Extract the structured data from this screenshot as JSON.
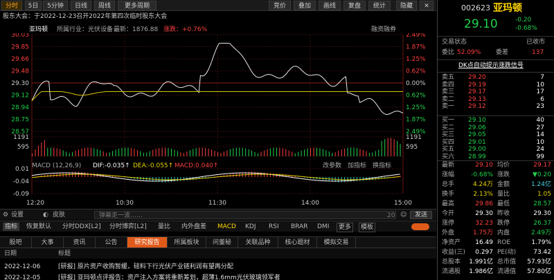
{
  "toolbar": {
    "tabs": [
      "分时",
      "5日",
      "5分钟",
      "日线",
      "周线",
      "更多周期"
    ],
    "right_buttons": [
      "竞价",
      "叠加",
      "画线",
      "复盘",
      "统计",
      "隐藏"
    ]
  },
  "notice": "股东大会：于2022-12-23召开2022年第四次临时股东大会",
  "chart_header": {
    "name": "亚玛顿",
    "industry": "所属行业：光伏设备",
    "latest": "最新：1876.88",
    "change": "涨跌：+0.76%",
    "margin": "融资融券"
  },
  "price_axis": {
    "left": [
      "30.03",
      "29.85",
      "29.66",
      "29.48",
      "29.30",
      "29.12",
      "28.94",
      "28.75",
      "28.57"
    ],
    "right": [
      "2.49%",
      "1.87%",
      "1.25%",
      "0.62%",
      "0.00%",
      "0.62%",
      "1.25%",
      "1.87%",
      "2.49%"
    ]
  },
  "volume_axis": {
    "left": [
      "1191",
      "595"
    ],
    "right": [
      "1191",
      "595"
    ]
  },
  "macd_header": {
    "name": "MACD (12,26,9)",
    "dif": "DIF:-0.035↑",
    "dea": "DEA:-0.055↑",
    "macd": "MACD:0.040↑",
    "buttons": [
      "改参数",
      "加指标",
      "换指标"
    ]
  },
  "macd_axis": {
    "left": [
      "0.01",
      "-0.04",
      "-0.09"
    ]
  },
  "time_axis": [
    "12:20",
    "10:30",
    "11:30",
    "14:00",
    "15:00"
  ],
  "input_bar": {
    "settings": "设置",
    "skin": "皮肤",
    "placeholder": "弹幕走一波……",
    "count": "20",
    "send": "发送"
  },
  "indicator_bar": {
    "items": [
      "指标",
      "恢复默认",
      "分时DDX[L2]",
      "分时博弈[L2]",
      "量比",
      "内外盘差",
      "MACD",
      "KDJ",
      "RSI",
      "BRAR",
      "DMI",
      "更多",
      "模板"
    ]
  },
  "tabs": [
    "股吧",
    "大事",
    "资讯",
    "公告",
    "研究报告",
    "所属板块",
    "问董秘",
    "关联品种",
    "核心题材",
    "模拟交易"
  ],
  "news_header": {
    "date": "日期",
    "title": "标题"
  },
  "news": [
    {
      "date": "2022-12-06",
      "text": "[研报] 原片资产收购暂缓，硅料下行光伏产业链利润有望再分配"
    },
    {
      "date": "2022-12-05",
      "text": "[研报] 亚玛顿点评报告：资产注入方案将重新筹划，超薄1.6mm光伏玻璃领军者"
    }
  ],
  "quote": {
    "code": "002623",
    "name": "亚玛顿",
    "price": "29.10",
    "change": "-0.20",
    "change_pct": "-0.68%",
    "status_label": "交易状态",
    "status": "已收市",
    "weibi_label": "委比",
    "weibi": "52.09%",
    "weicha_label": "委差",
    "weicha": "137",
    "dk_title": "DK点自动提示涨跌信号"
  },
  "sells": [
    {
      "label": "卖五",
      "price": "29.20",
      "vol": "7"
    },
    {
      "label": "卖四",
      "price": "29.19",
      "vol": "10"
    },
    {
      "label": "卖三",
      "price": "29.17",
      "vol": "17"
    },
    {
      "label": "卖二",
      "price": "29.13",
      "vol": "6"
    },
    {
      "label": "卖一",
      "price": "29.12",
      "vol": "23"
    }
  ],
  "buys": [
    {
      "label": "买一",
      "price": "29.10",
      "vol": "40"
    },
    {
      "label": "买二",
      "price": "29.06",
      "vol": "27"
    },
    {
      "label": "买三",
      "price": "29.05",
      "vol": "14"
    },
    {
      "label": "买四",
      "price": "29.01",
      "vol": "10"
    },
    {
      "label": "买五",
      "price": "29.00",
      "vol": "24"
    },
    {
      "label": "买六",
      "price": "28.99",
      "vol": "99"
    }
  ],
  "stats": [
    {
      "l1": "最新",
      "v1": "29.10",
      "c1": "red",
      "l2": "均价",
      "v2": "29.17",
      "c2": "red"
    },
    {
      "l1": "涨幅",
      "v1": "-0.68%",
      "c1": "green",
      "l2": "涨跌",
      "v2": "▼0.20",
      "c2": "green"
    },
    {
      "l1": "总手",
      "v1": "4.24万",
      "c1": "yellow",
      "l2": "金额",
      "v2": "1.24亿",
      "c2": "cyan"
    },
    {
      "l1": "换手",
      "v1": "2.13%",
      "c1": "yellow",
      "l2": "量比",
      "v2": "1.05",
      "c2": "yellow"
    },
    {
      "l1": "最高",
      "v1": "29.86",
      "c1": "red",
      "l2": "最低",
      "v2": "28.57",
      "c2": "green"
    },
    {
      "l1": "今开",
      "v1": "29.30",
      "c1": "white",
      "l2": "昨收",
      "v2": "29.30",
      "c2": "white"
    },
    {
      "l1": "涨停",
      "v1": "32.23",
      "c1": "red",
      "l2": "跌停",
      "v2": "26.37",
      "c2": "green"
    },
    {
      "l1": "外盘",
      "v1": "1.75万",
      "c1": "red",
      "l2": "内盘",
      "v2": "2.49万",
      "c2": "green"
    },
    {
      "l1": "净资产",
      "v1": "16.49",
      "c1": "white",
      "l2": "ROE",
      "v2": "1.79%",
      "c2": "white"
    },
    {
      "l1": "收益(三)",
      "v1": "0.297",
      "c1": "white",
      "l2": "PE(动)",
      "v2": "73.42",
      "c2": "white"
    },
    {
      "l1": "总股本",
      "v1": "1.991亿",
      "c1": "white",
      "l2": "总市值",
      "v2": "57.93亿",
      "c2": "white"
    },
    {
      "l1": "流通股",
      "v1": "1.986亿",
      "c1": "white",
      "l2": "流通值",
      "v2": "57.80亿",
      "c2": "white"
    }
  ],
  "colors": {
    "up": "#ff4040",
    "down": "#22d24c",
    "avg": "#e8d200",
    "accent": "#e05a1a"
  }
}
